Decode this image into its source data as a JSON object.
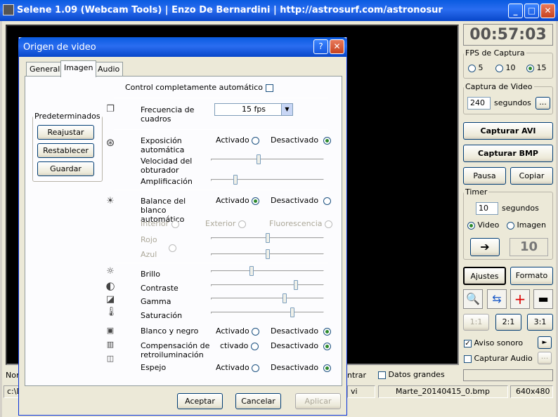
{
  "window": {
    "title": "Selene 1.09 (Webcam Tools)  |  Enzo De Bernardini  |  http://astrosurf.com/astronosur",
    "min": "_",
    "max": "□",
    "close": "✕"
  },
  "timer_display": "00:57:03",
  "fps_group": {
    "label": "FPS de Captura",
    "options": [
      "5",
      "10",
      "15"
    ],
    "selected": "15"
  },
  "video_capture": {
    "label": "Captura de Video",
    "value": "240",
    "unit": "segundos",
    "browse": "..."
  },
  "buttons": {
    "capture_avi": "Capturar AVI",
    "capture_bmp": "Capturar BMP",
    "pause": "Pausa",
    "copy": "Copiar",
    "settings": "Ajustes",
    "format": "Formato"
  },
  "timer_group": {
    "label": "Timer",
    "value": "10",
    "unit": "segundos",
    "video": "Video",
    "image": "Imagen",
    "selected": "Video",
    "go": "➔",
    "count": "10"
  },
  "zoom": {
    "z1": "1:1",
    "z2": "2:1",
    "z3": "3:1"
  },
  "audio": {
    "alert": "Aviso sonoro",
    "alert_checked": true,
    "capture": "Capturar Audio",
    "capture_checked": false,
    "play": "►",
    "browse": "..."
  },
  "bottom": {
    "left_label": "Nor",
    "mid_label": "ntrar",
    "big_data": "Datos grandes"
  },
  "statusbar": {
    "path": "c:\\D",
    "ext": "vi",
    "file": "Marte_20140415_0.bmp",
    "resolution": "640x480"
  },
  "dialog": {
    "title": "Origen de video",
    "help": "?",
    "close": "✕",
    "tabs": [
      "General",
      "Imagen",
      "Audio"
    ],
    "active_tab": "Imagen",
    "auto_control": "Control completamente automático",
    "presets": {
      "label": "Predeterminados",
      "readjust": "Reajustar",
      "restore": "Restablecer",
      "save": "Guardar"
    },
    "frame_rate": {
      "label": "Frecuencia de cuadros",
      "value": "15 fps"
    },
    "exposure": {
      "label": "Exposición automática",
      "on": "Activado",
      "off": "Desactivado",
      "selected": "off"
    },
    "shutter": {
      "label": "Velocidad del obturador",
      "value": 0.42
    },
    "gain": {
      "label": "Amplificación",
      "value": 0.22
    },
    "white_balance": {
      "label": "Balance del blanco automático",
      "on": "Activado",
      "off": "Desactivado",
      "selected": "on"
    },
    "wb_modes": {
      "indoor": "Interior",
      "outdoor": "Exterior",
      "fluorescent": "Fluorescencia"
    },
    "red": {
      "label": "Rojo",
      "value": 0.5
    },
    "blue": {
      "label": "Azul",
      "value": 0.5
    },
    "brightness": {
      "label": "Brillo",
      "value": 0.36
    },
    "contrast": {
      "label": "Contraste",
      "value": 0.75
    },
    "gamma": {
      "label": "Gamma",
      "value": 0.65
    },
    "saturation": {
      "label": "Saturación",
      "value": 0.72
    },
    "bw": {
      "label": "Blanco y negro",
      "on": "Activado",
      "off": "Desactivado",
      "selected": "off"
    },
    "backlight": {
      "label": "Compensación de retroiluminación",
      "on": "ctivado",
      "off": "Desactivado",
      "selected": "off"
    },
    "mirror": {
      "label": "Espejo",
      "on": "Activado",
      "off": "Desactivado",
      "selected": "off"
    },
    "ok": "Aceptar",
    "cancel": "Cancelar",
    "apply": "Aplicar"
  }
}
